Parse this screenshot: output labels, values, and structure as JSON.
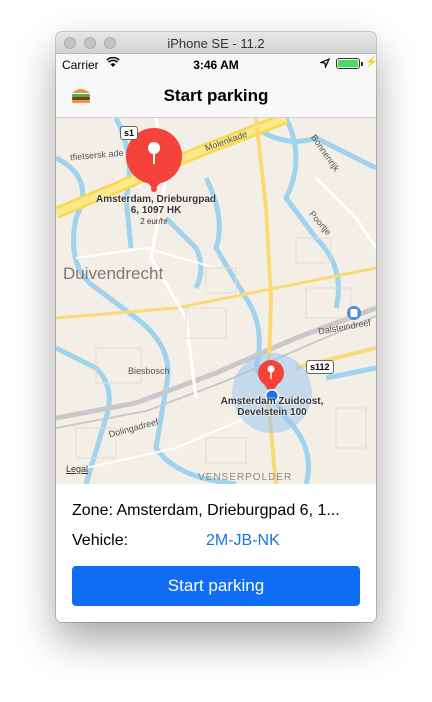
{
  "window": {
    "title": "iPhone SE - 11.2"
  },
  "status_bar": {
    "carrier": "Carrier",
    "time": "3:46 AM"
  },
  "nav": {
    "title": "Start parking"
  },
  "map": {
    "district": "Duivendrecht",
    "neighborhood": "VENSERPOLDER",
    "street_labels": [
      "Molenkade",
      "Bonnenrijk",
      "Dalsteindreef",
      "Biesbosch",
      "Dolingadreef",
      "Poortje"
    ],
    "road_shield": "s112",
    "zone_pin": {
      "label_line1": "Amsterdam, Drieburgpad",
      "label_line2": "6, 1097 HK",
      "rate": "2 eur/hr"
    },
    "other_pin": {
      "label_line1": "Amsterdam Zuidoost,",
      "label_line2": "Develstein 100"
    },
    "legal": "Legal"
  },
  "panel": {
    "zone_label": "Zone:",
    "zone_value": "Amsterdam, Drieburgpad 6, 1...",
    "vehicle_label": "Vehicle:",
    "vehicle_value": "2M-JB-NK",
    "start_button": "Start parking"
  },
  "colors": {
    "accent": "#0f6df5",
    "pin": "#f5423a",
    "user_location": "#1a73e8"
  }
}
